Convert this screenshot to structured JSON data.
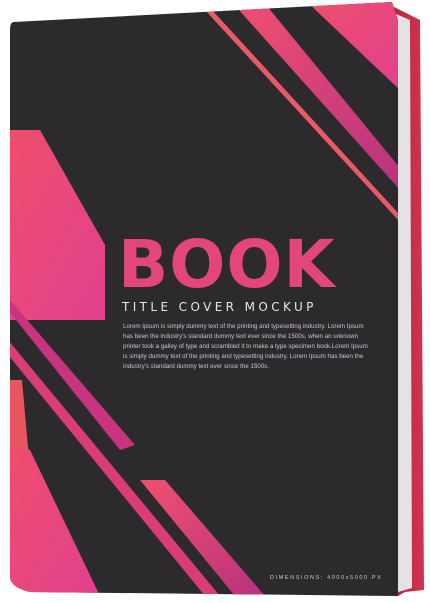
{
  "cover": {
    "title": "BOOK",
    "subtitle": "TITLE COVER MOCKUP",
    "body_text": "Lorem Ipsum is simply dummy text of the printing and typesetting industry. Lorem Ipsum has been the industry's standard dummy text ever since the 1500s, when an unknown printer took a galley of type and scrambled it to make a type specimen book.Lorem Ipsum is simply dummy text of the printing and typesetting industry. Lorem Ipsum has been the industry's standard dummy text ever since the 1500s.",
    "dimensions_label": "DIMENSIONS: 4000x5000 PX"
  },
  "colors": {
    "cover_background": "#2d2a2e",
    "accent_pink": "#e2467a",
    "accent_magenta": "#c93a7f",
    "accent_coral": "#ea5a5f",
    "spine": "#c72d4f",
    "page_edge": "#d9d9d9"
  }
}
